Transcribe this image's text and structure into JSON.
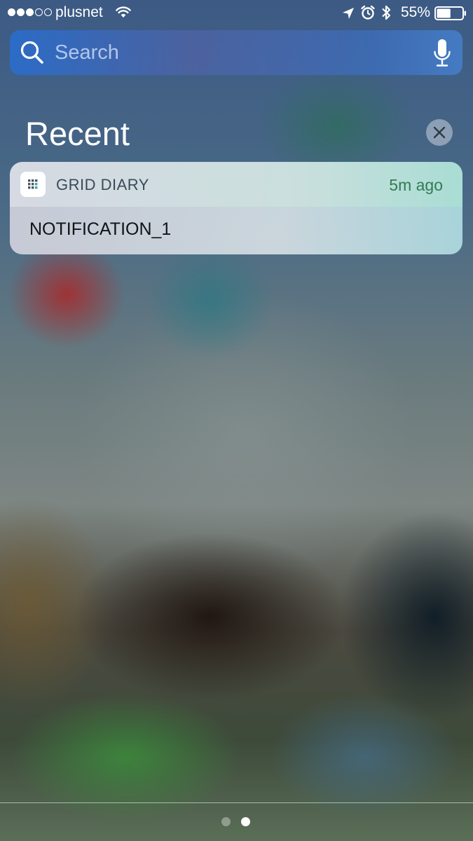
{
  "status_bar": {
    "signal_bars_filled": 3,
    "signal_bars_total": 5,
    "carrier": "plusnet",
    "battery_percent": "55%",
    "battery_level": 0.55,
    "icons": [
      "wifi-icon",
      "location-icon",
      "alarm-icon",
      "bluetooth-icon",
      "battery-icon"
    ]
  },
  "search": {
    "placeholder": "Search",
    "value": "",
    "icon": "search-icon",
    "mic_icon": "mic-icon"
  },
  "recent": {
    "title": "Recent",
    "clear_icon": "close-icon"
  },
  "notification": {
    "app_name": "GRID DIARY",
    "timestamp": "5m ago",
    "body": "NOTIFICATION_1",
    "app_icon": "grid-diary-app-icon"
  },
  "pager": {
    "page_count": 2,
    "current_page": 2
  },
  "colors": {
    "search_bar": "#3c6ed2",
    "timestamp": "#357a55",
    "app_name": "#3b4a58"
  }
}
